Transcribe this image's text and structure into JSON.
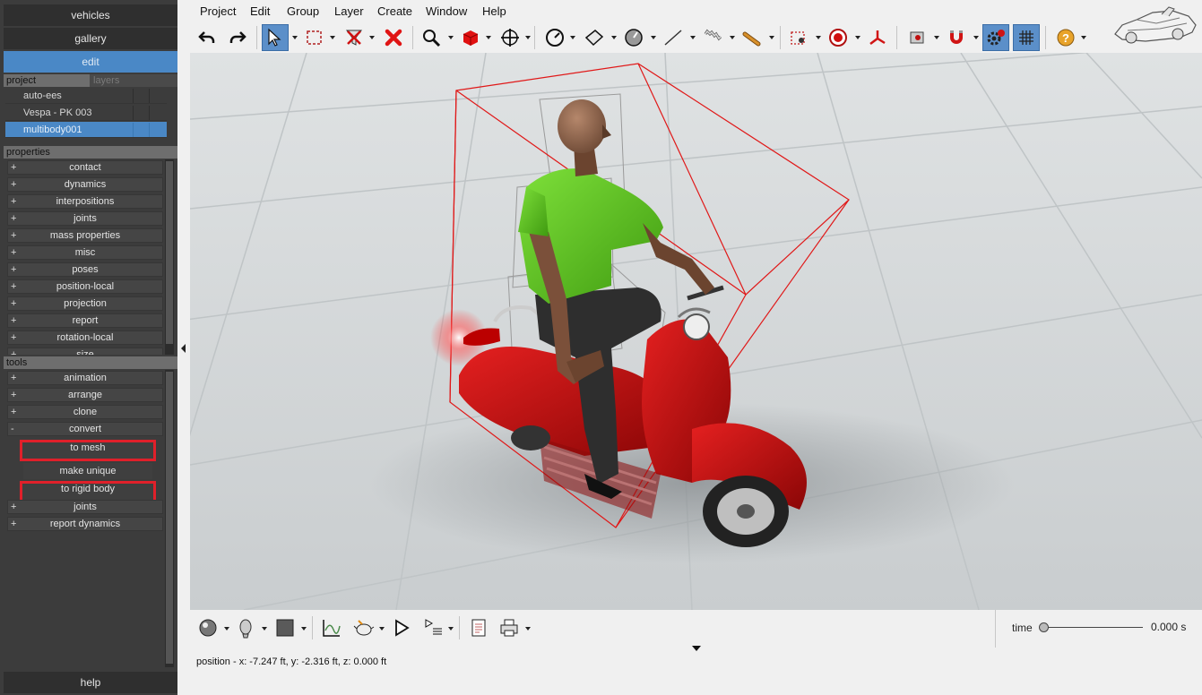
{
  "nav": {
    "vehicles": "vehicles",
    "gallery": "gallery",
    "edit": "edit"
  },
  "project_panel": {
    "tab_project": "project",
    "tab_layers": "layers",
    "items": [
      "auto-ees",
      "Vespa - PK 003",
      "multibody001"
    ],
    "selected_index": 2
  },
  "properties": {
    "header": "properties",
    "items": [
      "contact",
      "dynamics",
      "interpositions",
      "joints",
      "mass properties",
      "misc",
      "poses",
      "position-local",
      "projection",
      "report",
      "rotation-local",
      "size"
    ]
  },
  "tools": {
    "header": "tools",
    "items_before": [
      "animation",
      "arrange",
      "clone"
    ],
    "expanded": "convert",
    "convert_actions": [
      "to mesh",
      "make unique",
      "to rigid body"
    ],
    "items_after": [
      "joints",
      "report dynamics"
    ]
  },
  "help": "help",
  "menu": [
    "Project",
    "Edit",
    "Group",
    "Layer",
    "Create",
    "Window",
    "Help"
  ],
  "toolbar_icons": [
    "undo-icon",
    "redo-icon",
    "select-arrow-icon",
    "select-box-icon",
    "filter-icon",
    "delete-icon",
    "zoom-icon",
    "cube-icon",
    "move-icon",
    "gauge-icon",
    "plane-icon",
    "dial-icon",
    "line-icon",
    "spring-icon",
    "cylinder-icon",
    "camera-target-icon",
    "target-icon",
    "axes-icon",
    "record-icon",
    "magnet-icon",
    "settings-icon",
    "grid-icon",
    "help-icon"
  ],
  "bottom": {
    "time_label": "time",
    "time_value": "0.000 s",
    "time_fraction": 0.0,
    "status": "position - x: -7.247 ft, y: -2.316 ft, z: 0.000 ft"
  },
  "colors": {
    "accent": "#4a88c6",
    "highlight_box": "#e0202a",
    "panel": "#3c3c3c",
    "scooter_red": "#c41010",
    "shirt_green": "#5ec01c"
  }
}
